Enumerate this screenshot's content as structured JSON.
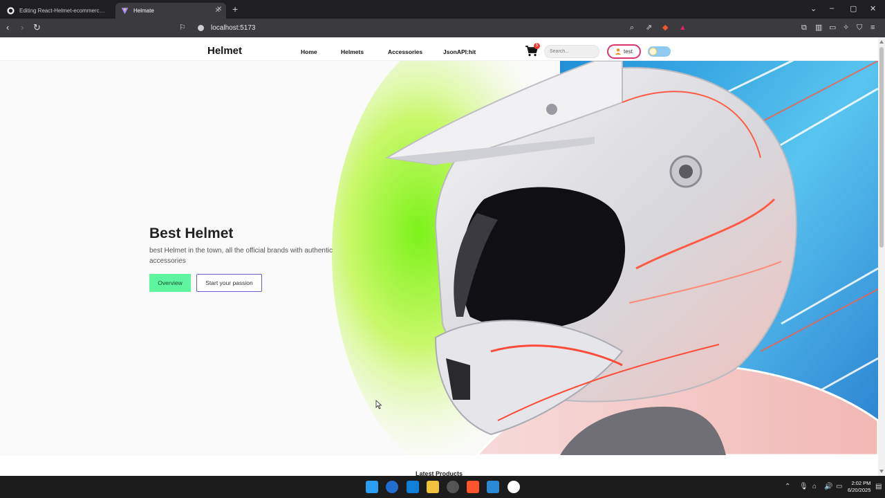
{
  "browser": {
    "tabs": [
      {
        "title": "Editing React-Helmet-ecommerce/R",
        "active": false
      },
      {
        "title": "Helmate",
        "active": true
      }
    ],
    "url": "localhost:5173"
  },
  "site": {
    "brand": "Helmet",
    "nav": [
      "Home",
      "Helmets",
      "Accessories",
      "JsonAPI:hit"
    ],
    "cart_count": "5",
    "search_placeholder": "Search...",
    "user_label": "test"
  },
  "hero": {
    "title": "Best Helmet",
    "subtitle": "best Helmet in the town, all the official brands with authentic accessories",
    "primary_button": "Overview",
    "secondary_button": "Start your passion"
  },
  "sections": {
    "latest_title": "Latest Products"
  },
  "taskbar": {
    "time": "2:02 PM",
    "date": "6/20/2025"
  },
  "colors": {
    "accent_green": "#5ff5a0",
    "accent_purple": "#6a5acd",
    "user_border": "#d9346b"
  }
}
